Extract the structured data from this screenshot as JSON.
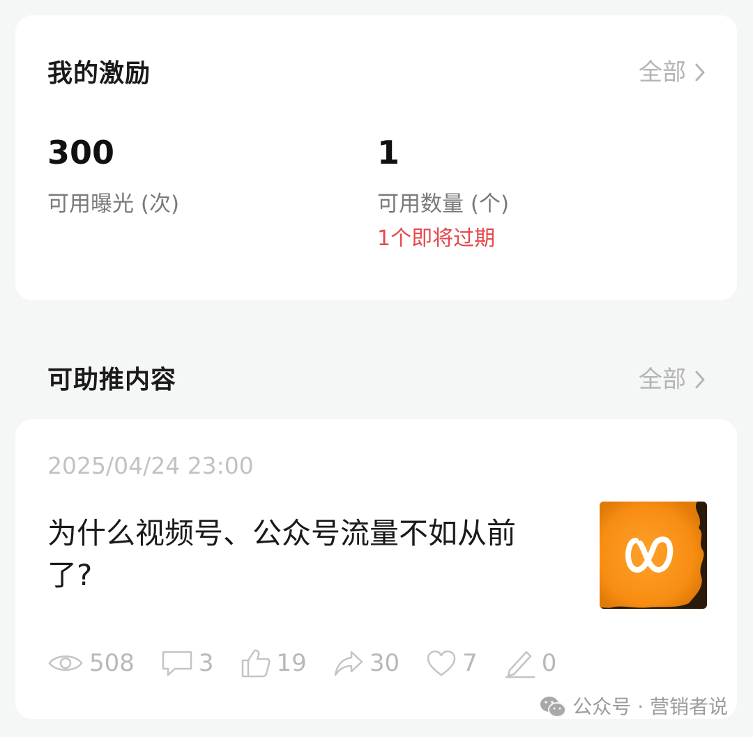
{
  "incentive": {
    "title": "我的激励",
    "more_label": "全部",
    "stats": [
      {
        "value": "300",
        "label": "可用曝光 (次)"
      },
      {
        "value": "1",
        "label": "可用数量 (个)",
        "warning": "1个即将过期"
      }
    ],
    "warning_color": "#e5484d"
  },
  "promotable": {
    "title": "可助推内容",
    "more_label": "全部"
  },
  "post": {
    "date": "2025/04/24 23:00",
    "title": "为什么视频号、公众号流量不如从前了?",
    "thumbnail_icon": "channels-logo-icon",
    "thumbnail_color": "#f7931e",
    "metrics": [
      {
        "icon": "eye-icon",
        "value": "508"
      },
      {
        "icon": "comment-icon",
        "value": "3"
      },
      {
        "icon": "thumbs-up-icon",
        "value": "19"
      },
      {
        "icon": "share-icon",
        "value": "30"
      },
      {
        "icon": "heart-icon",
        "value": "7"
      },
      {
        "icon": "pen-icon",
        "value": "0"
      }
    ]
  },
  "watermark": {
    "text": "公众号 · 营销者说",
    "icon": "wechat-icon"
  }
}
